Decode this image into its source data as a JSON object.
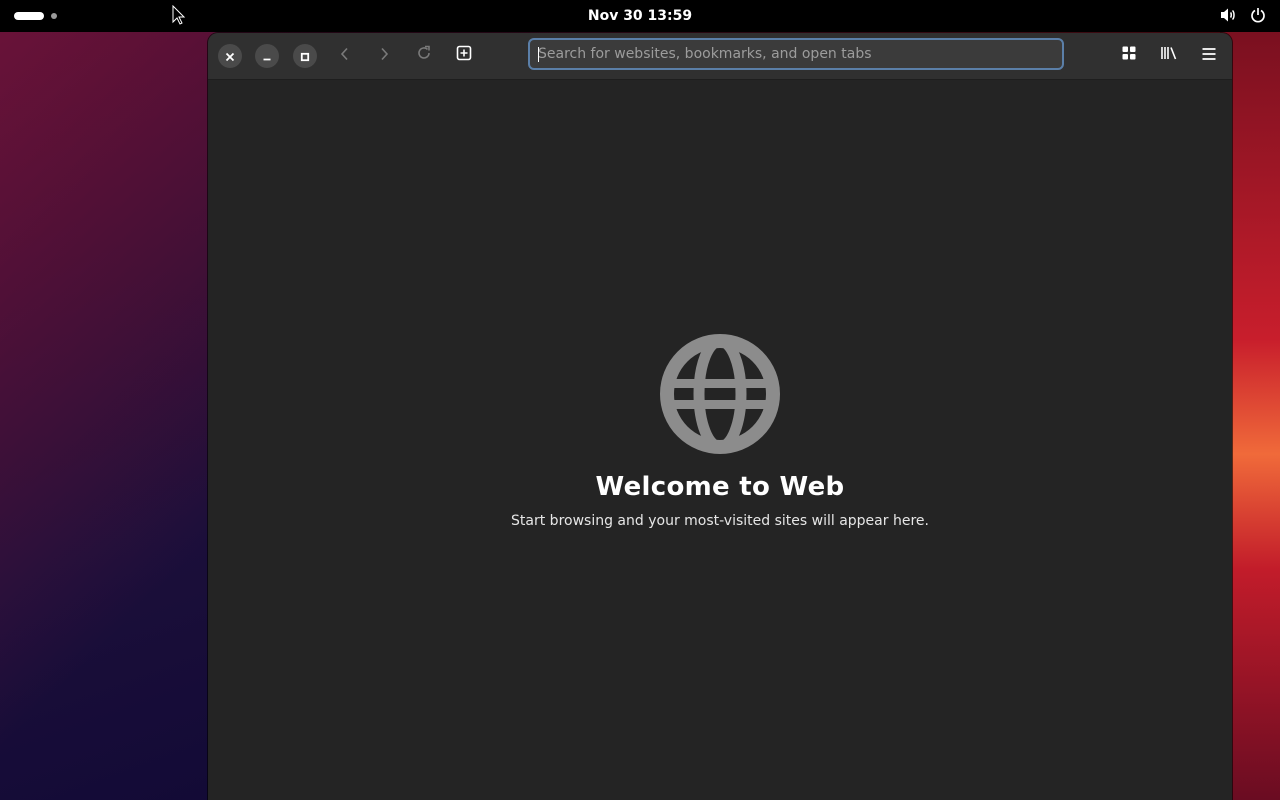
{
  "topbar": {
    "clock": "Nov 30  13:59",
    "activities_icon": "workspace-indicator",
    "volume_icon": "speaker-icon",
    "power_icon": "power-icon"
  },
  "browser": {
    "window_buttons": {
      "close_icon": "close-icon",
      "minimize_icon": "minimize-icon",
      "maximize_icon": "maximize-icon"
    },
    "nav": {
      "back_icon": "chevron-left-icon",
      "forward_icon": "chevron-right-icon",
      "reload_icon": "reload-icon",
      "new_tab_icon": "new-tab-icon"
    },
    "search": {
      "placeholder": "Search for websites, bookmarks, and open tabs",
      "value": ""
    },
    "toolbar_right": {
      "tabs_overview_icon": "grid-icon",
      "library_icon": "library-icon",
      "menu_icon": "hamburger-menu-icon"
    }
  },
  "welcome": {
    "title": "Welcome to Web",
    "subtitle": "Start browsing and your most-visited sites will appear here.",
    "icon": "globe-icon"
  },
  "colors": {
    "accent_focus": "#5b7fa8",
    "window_bg": "#242424",
    "headerbar_bg": "#303030"
  }
}
